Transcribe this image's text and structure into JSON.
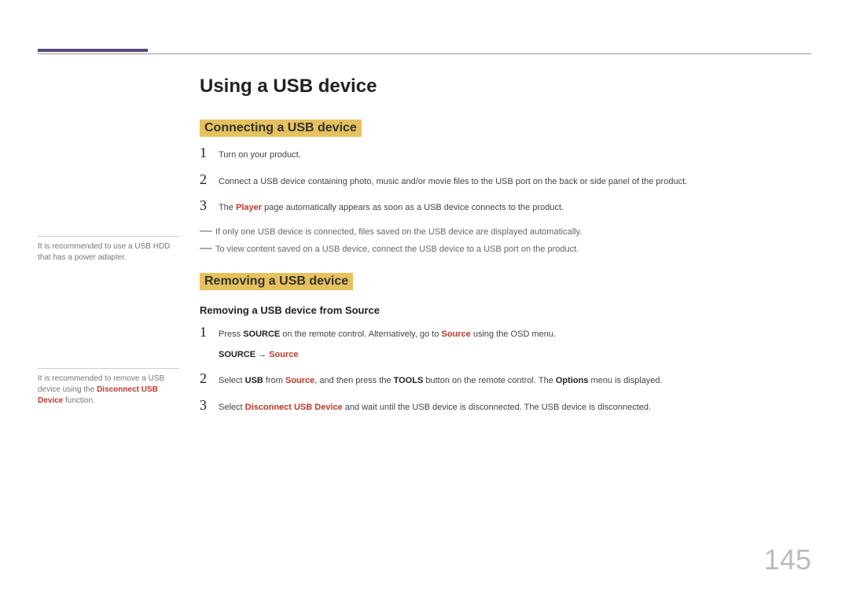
{
  "title": "Using a USB device",
  "section1": {
    "heading": "Connecting a USB device",
    "steps": [
      {
        "num": "1",
        "parts": [
          {
            "t": "Turn on your product."
          }
        ]
      },
      {
        "num": "2",
        "parts": [
          {
            "t": "Connect a USB device containing photo, music and/or movie files to the USB port on the back or side panel of the product."
          }
        ]
      },
      {
        "num": "3",
        "parts": [
          {
            "t": "The "
          },
          {
            "t": "Player",
            "cls": "accent"
          },
          {
            "t": " page automatically appears as soon as a USB device connects to the product."
          }
        ]
      }
    ],
    "notes": [
      "If only one USB device is connected, files saved on the USB device are displayed automatically.",
      "To view content saved on a USB device, connect the USB device to a USB port on the product."
    ]
  },
  "section2": {
    "heading": "Removing a USB device",
    "subheading": "Removing a USB device from Source",
    "steps": [
      {
        "num": "1",
        "parts": [
          {
            "t": "Press "
          },
          {
            "t": "SOURCE",
            "cls": "bold"
          },
          {
            "t": " on the remote control. Alternatively, go to "
          },
          {
            "t": "Source",
            "cls": "accent"
          },
          {
            "t": " using the OSD menu."
          }
        ]
      },
      {
        "num": "2",
        "parts": [
          {
            "t": "Select "
          },
          {
            "t": "USB",
            "cls": "bold"
          },
          {
            "t": " from "
          },
          {
            "t": "Source",
            "cls": "accent"
          },
          {
            "t": ", and then press the "
          },
          {
            "t": "TOOLS",
            "cls": "bold"
          },
          {
            "t": " button on the remote control. The "
          },
          {
            "t": "Options",
            "cls": "bold"
          },
          {
            "t": " menu is displayed."
          }
        ]
      },
      {
        "num": "3",
        "parts": [
          {
            "t": "Select "
          },
          {
            "t": "Disconnect USB Device",
            "cls": "accent"
          },
          {
            "t": " and wait until the USB device is disconnected. The USB device is disconnected."
          }
        ]
      }
    ],
    "path": {
      "pre": "SOURCE",
      "arrow": " → ",
      "post": "Source"
    }
  },
  "side1": "It is recommended to use a USB HDD that has a power adapter.",
  "side2": {
    "pre": "It is recommended to remove a USB device using the ",
    "hl": "Disconnect USB Device",
    "post": " function."
  },
  "pageNumber": "145"
}
